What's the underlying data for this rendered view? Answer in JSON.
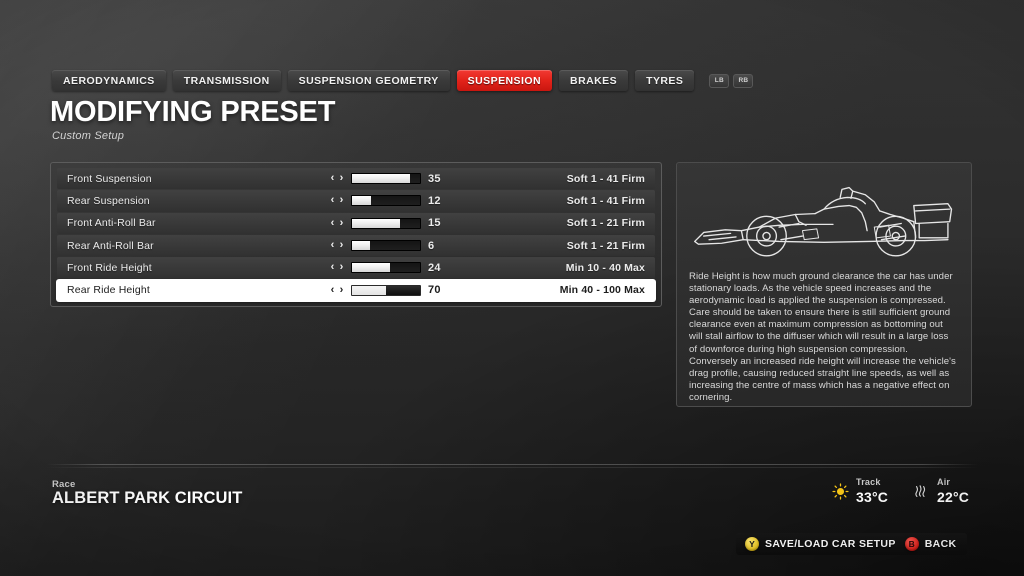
{
  "tabs": [
    {
      "label": "AERODYNAMICS",
      "active": false
    },
    {
      "label": "TRANSMISSION",
      "active": false
    },
    {
      "label": "SUSPENSION GEOMETRY",
      "active": false
    },
    {
      "label": "SUSPENSION",
      "active": true
    },
    {
      "label": "BRAKES",
      "active": false
    },
    {
      "label": "TYRES",
      "active": false
    }
  ],
  "shoulder_buttons": [
    {
      "label": "LB"
    },
    {
      "label": "RB"
    }
  ],
  "header": {
    "title": "MODIFYING PRESET",
    "subtitle": "Custom Setup"
  },
  "settings": [
    {
      "label": "Front Suspension",
      "value": "35",
      "range": "Soft 1 - 41 Firm",
      "fill_percent": 85,
      "selected": false,
      "left_arrow": "‹",
      "right_arrow": "›"
    },
    {
      "label": "Rear Suspension",
      "value": "12",
      "range": "Soft 1 - 41 Firm",
      "fill_percent": 28,
      "selected": false,
      "left_arrow": "‹",
      "right_arrow": "›"
    },
    {
      "label": "Front Anti-Roll Bar",
      "value": "15",
      "range": "Soft 1 - 21 Firm",
      "fill_percent": 71,
      "selected": false,
      "left_arrow": "‹",
      "right_arrow": "›"
    },
    {
      "label": "Rear Anti-Roll Bar",
      "value": "6",
      "range": "Soft 1 - 21 Firm",
      "fill_percent": 27,
      "selected": false,
      "left_arrow": "‹",
      "right_arrow": "›"
    },
    {
      "label": "Front Ride Height",
      "value": "24",
      "range": "Min 10 - 40 Max",
      "fill_percent": 56,
      "selected": false,
      "left_arrow": "‹",
      "right_arrow": "›"
    },
    {
      "label": "Rear Ride Height",
      "value": "70",
      "range": "Min 40 - 100 Max",
      "fill_percent": 50,
      "selected": true,
      "left_arrow": "‹",
      "right_arrow": "›"
    }
  ],
  "info": {
    "description": "Ride Height is how much ground clearance the car has under stationary loads. As the vehicle speed increases and the aerodynamic load is applied the suspension is compressed. Care should be taken to ensure there is still sufficient ground clearance even at maximum compression as bottoming out will stall airflow to the diffuser which will result in a large loss of downforce during high suspension compression. Conversely an increased ride height will increase the vehicle's drag profile, causing reduced straight line speeds, as well as increasing the centre of mass which has a negative effect on cornering."
  },
  "footer": {
    "race_label": "Race",
    "circuit": "ALBERT PARK CIRCUIT",
    "weather": {
      "track_label": "Track",
      "track_value": "33°C",
      "air_label": "Air",
      "air_value": "22°C"
    }
  },
  "actions": [
    {
      "button": "Y",
      "label": "SAVE/LOAD CAR SETUP"
    },
    {
      "button": "B",
      "label": "BACK"
    }
  ],
  "colors": {
    "accent_red": "#e2231a",
    "button_y": "#e8c21c",
    "button_b": "#e01f19",
    "sun_yellow": "#f5c518"
  }
}
